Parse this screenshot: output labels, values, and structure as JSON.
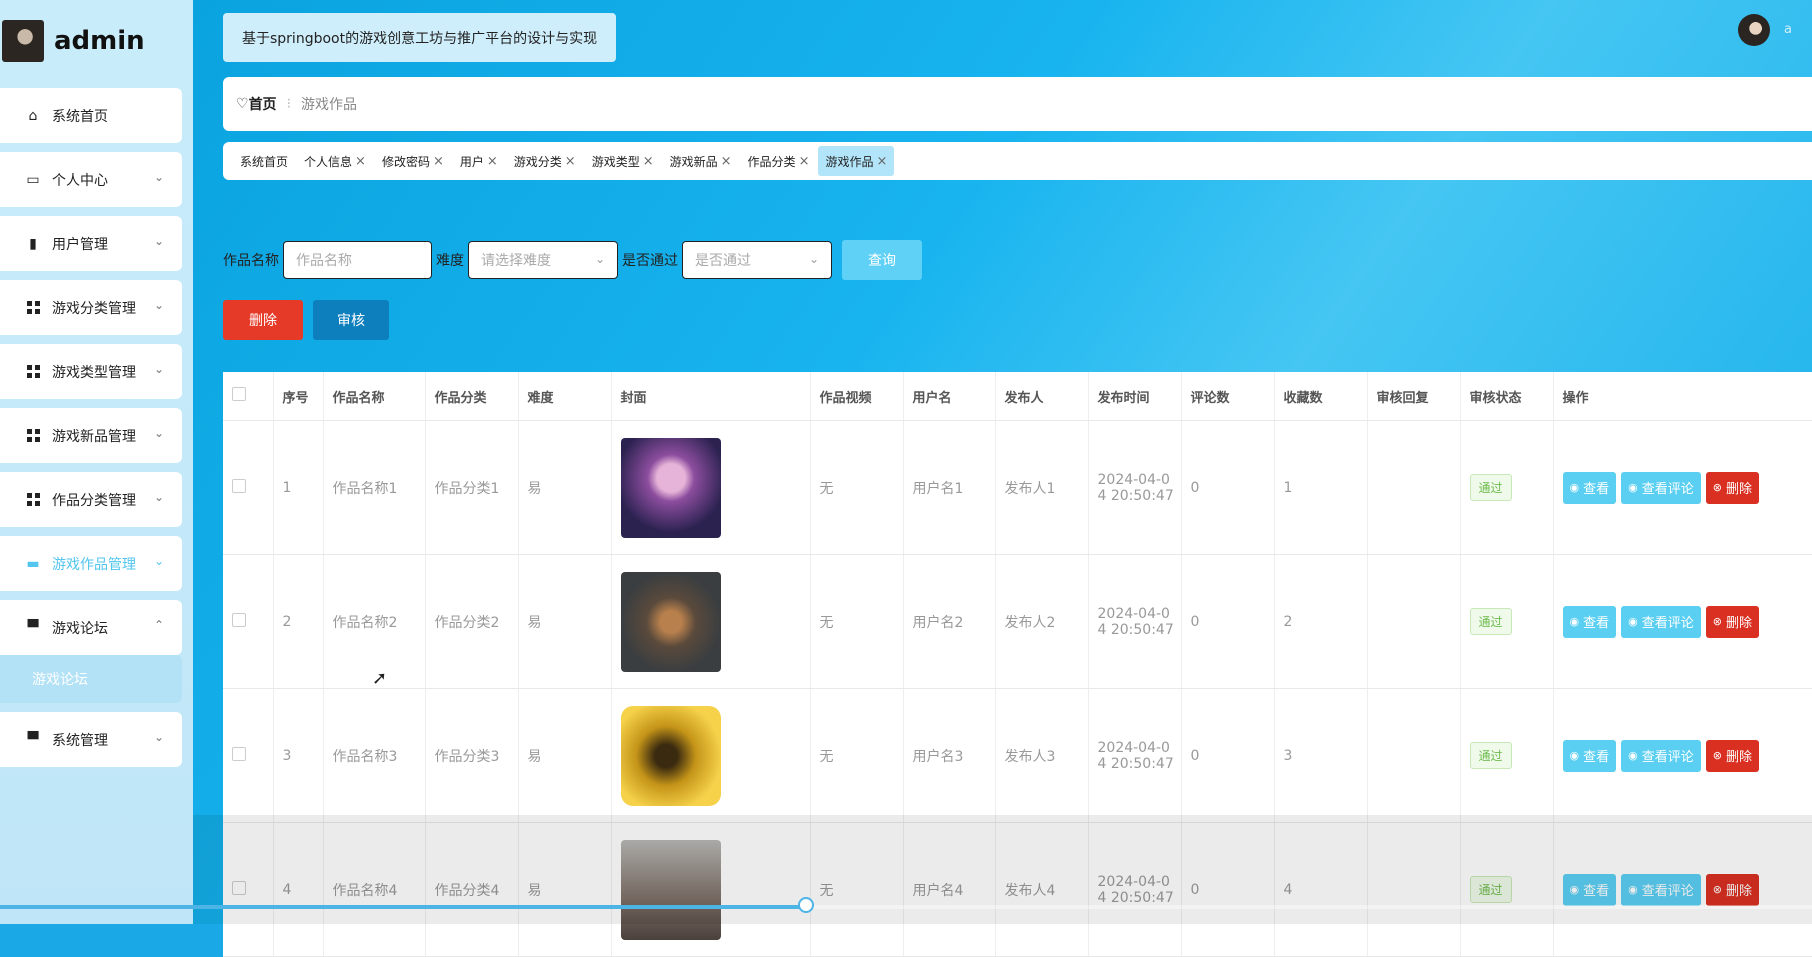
{
  "sidebar": {
    "brand": "admin",
    "items": [
      {
        "label": "系统首页",
        "icon": "home-icon",
        "has_chevron": false
      },
      {
        "label": "个人中心",
        "icon": "card-icon",
        "has_chevron": true
      },
      {
        "label": "用户管理",
        "icon": "book-icon",
        "has_chevron": true
      },
      {
        "label": "游戏分类管理",
        "icon": "grid-icon",
        "has_chevron": true
      },
      {
        "label": "游戏类型管理",
        "icon": "grid-icon",
        "has_chevron": true
      },
      {
        "label": "游戏新品管理",
        "icon": "grid-icon",
        "has_chevron": true
      },
      {
        "label": "作品分类管理",
        "icon": "grid-icon",
        "has_chevron": true
      },
      {
        "label": "游戏作品管理",
        "icon": "chat-icon",
        "has_chevron": true
      },
      {
        "label": "游戏论坛",
        "icon": "monitor-icon",
        "has_chevron": true
      },
      {
        "label": "系统管理",
        "icon": "monitor-icon",
        "has_chevron": true
      }
    ],
    "sub_item": "游戏论坛"
  },
  "header": {
    "title": "基于springboot的游戏创意工坊与推广平台的设计与实现",
    "user_initial": "a"
  },
  "breadcrumb": {
    "home": "首页",
    "current": "游戏作品"
  },
  "tags": [
    "系统首页",
    "个人信息",
    "修改密码",
    "用户",
    "游戏分类",
    "游戏类型",
    "游戏新品",
    "作品分类",
    "游戏作品"
  ],
  "search": {
    "name_label": "作品名称",
    "name_placeholder": "作品名称",
    "difficulty_label": "难度",
    "difficulty_placeholder": "请选择难度",
    "passed_label": "是否通过",
    "passed_placeholder": "是否通过",
    "query_button": "查询"
  },
  "actions": {
    "delete": "删除",
    "audit": "审核"
  },
  "table": {
    "headers": [
      "序号",
      "作品名称",
      "作品分类",
      "难度",
      "封面",
      "作品视频",
      "用户名",
      "发布人",
      "发布时间",
      "评论数",
      "收藏数",
      "审核回复",
      "审核状态",
      "操作"
    ],
    "rows": [
      {
        "no": "1",
        "name": "作品名称1",
        "category": "作品分类1",
        "difficulty": "易",
        "video": "无",
        "username": "用户名1",
        "publisher": "发布人1",
        "time_line1": "2024-04-0",
        "time_line2": "4 20:50:47",
        "comments": "0",
        "favorites": "1",
        "reply": "",
        "status": "通过"
      },
      {
        "no": "2",
        "name": "作品名称2",
        "category": "作品分类2",
        "difficulty": "易",
        "video": "无",
        "username": "用户名2",
        "publisher": "发布人2",
        "time_line1": "2024-04-0",
        "time_line2": "4 20:50:47",
        "comments": "0",
        "favorites": "2",
        "reply": "",
        "status": "通过"
      },
      {
        "no": "3",
        "name": "作品名称3",
        "category": "作品分类3",
        "difficulty": "易",
        "video": "无",
        "username": "用户名3",
        "publisher": "发布人3",
        "time_line1": "2024-04-0",
        "time_line2": "4 20:50:47",
        "comments": "0",
        "favorites": "3",
        "reply": "",
        "status": "通过"
      },
      {
        "no": "4",
        "name": "作品名称4",
        "category": "作品分类4",
        "difficulty": "易",
        "video": "无",
        "username": "用户名4",
        "publisher": "发布人4",
        "time_line1": "2024-04-0",
        "time_line2": "4 20:50:47",
        "comments": "0",
        "favorites": "4",
        "reply": "",
        "status": "通过"
      }
    ],
    "op_view": "查看",
    "op_view_comments": "查看评论",
    "op_delete": "删除"
  },
  "video_progress": 0.445,
  "colors": {
    "accent": "#5bcff2",
    "danger": "#d93021",
    "audit": "#0d7fbd",
    "status_green": "#6dbb4d"
  }
}
